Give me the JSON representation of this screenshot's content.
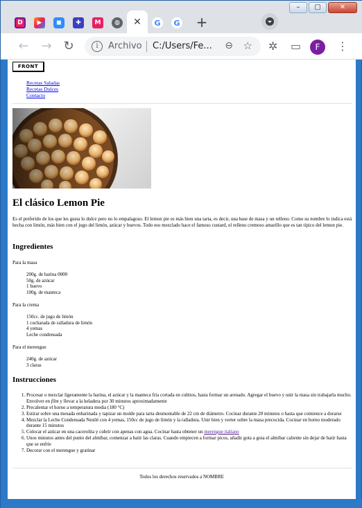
{
  "window": {
    "minimize_label": "–",
    "maximize_label": "▢",
    "close_label": "✕"
  },
  "tabs": [
    {
      "icon": "design-app-favicon",
      "glyph": "D",
      "color": "#e91e63"
    },
    {
      "icon": "media-app-favicon",
      "glyph": "▶",
      "color": "#ff5722"
    },
    {
      "icon": "zoom-favicon",
      "glyph": "◼",
      "color": "#2d8cff"
    },
    {
      "icon": "grid-app-favicon",
      "glyph": "✚",
      "color": "#3d3dbf"
    },
    {
      "icon": "miro-favicon",
      "glyph": "M",
      "color": "#e91e63"
    },
    {
      "icon": "globe-favicon",
      "glyph": "◍",
      "color": "#5f6368"
    },
    {
      "icon": "close-tab-icon",
      "glyph": "✕",
      "active": true
    },
    {
      "icon": "google-favicon",
      "glyph": "G",
      "color": "#4285f4"
    },
    {
      "icon": "google-favicon",
      "glyph": "G",
      "color": "#4285f4"
    }
  ],
  "toolbar": {
    "omnibox_label": "Archivo",
    "url": "C:/Users/Fe...",
    "profile_initial": "F"
  },
  "page": {
    "logo_text": "FRONT",
    "nav": [
      "Recetas Saladas",
      "Recetas Dulces",
      "Contacto"
    ],
    "title": "El clásico Lemon Pie",
    "intro": "Es el preferido de los que les gusta lo dulce pero no lo empalagoso. El lemon pie es más bien una tarta, es decir, una base de masa y un relleno. Como su nombre lo indica está hecha con limón, más bien con el jugo del limón, azúcar y huevos. Todo eso mezclado hace el famoso custard, el relleno cremoso amarillo que es tan típico del lemon pie.",
    "ingredients_heading": "Ingredientes",
    "masa_label": "Para la masa",
    "masa_items": [
      "200g. de harina 0000",
      "50g. de azúcar",
      "1 huevo",
      "100g. de manteca"
    ],
    "crema_label": "Para la crema",
    "crema_items": [
      "150cc. de jugo de limón",
      "1 cucharada de ralladura de limón",
      "4 yemas",
      "Leche condensada"
    ],
    "merengue_label": "Para el merengue",
    "merengue_items": [
      "240g. de azúcar",
      "3 claras"
    ],
    "instructions_heading": "Instrucciones",
    "step1_a": "Procesar o mezclar ligeramente la harina, el azúcar y la manteca fría cortada en cubitos, hasta formar un arenado. Agregar el huevo y unir la masa sin trabajarla mucho. Envolver en ",
    "step1_em": "film",
    "step1_b": " y llevar a la heladera por 30 minutos aproximadamente",
    "step2": "Precalentar el horno a temperatura media (180 °C)",
    "step3": "Estirar sobre una mesada enharinada y tapizar un molde para tarta desmontable de 22 cm de diámetro. Cocinar durante 20 minutos o hasta que comience a dorarse",
    "step4": "Mezclar la Leche Condensada Nestlé con 4 yemas, 150cc de jugo de limón y la ralladura. Unir bien y verter sobre la masa precocida. Cocinar en horno moderado durante 15 minutos",
    "step5_a": "Colocar el azúcar en una cacerolita y cubrir con apenas con agua. Cocinar hasta obtener un ",
    "step5_link": "merengue italiano",
    "step6": "Unos minutos antes del punto del almíbar, comenzar a batir las claras. Cuando empiecen a formar picos, añadir gota a gota el almíbar caliente sin dejar de batir hasta que se enfríe",
    "step7": "Decorar con el merengue y gratinar",
    "footer": "Todos los derechos reservados a NOMBRE"
  }
}
